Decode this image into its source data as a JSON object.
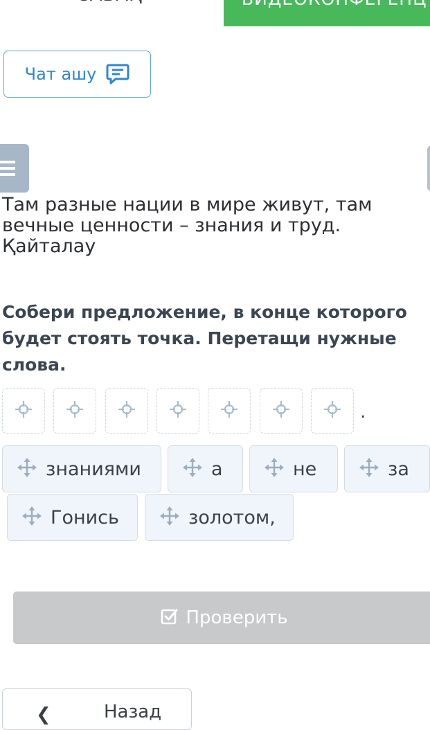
{
  "tabs": {
    "lesson_label": "САБАҚ",
    "video_label": "ВИДЕОКОНФЕРЕНЦ"
  },
  "chat": {
    "label": "Чат ашу",
    "icon": "chat-bubble-icon"
  },
  "task": {
    "sentence": "Там разные нации в мире живут, там вечные ценности – знания и труд.",
    "repeat_label": "Қайталау",
    "instruction": "Собери предложение, в конце которого будет стоять точка. Перетащи нужные слова.",
    "slot_count": 7,
    "end_mark": ".",
    "words": [
      "знаниями",
      "а",
      "не",
      "за",
      "Гонись",
      "золотом,"
    ]
  },
  "check_button": {
    "label": "Проверить",
    "icon": "checkbox-check-icon"
  },
  "back_button": {
    "label": "Назад",
    "icon": "arrow-left-icon"
  },
  "colors": {
    "video_tab": "#48b95a",
    "chat_accent": "#2f86d4",
    "menu_handle": "#a7b7c7",
    "chip_bg": "#eff5fa",
    "move_icon": "#9eadbd",
    "slot_icon": "#a9bccd",
    "check_disabled": "#c7c9cb"
  }
}
